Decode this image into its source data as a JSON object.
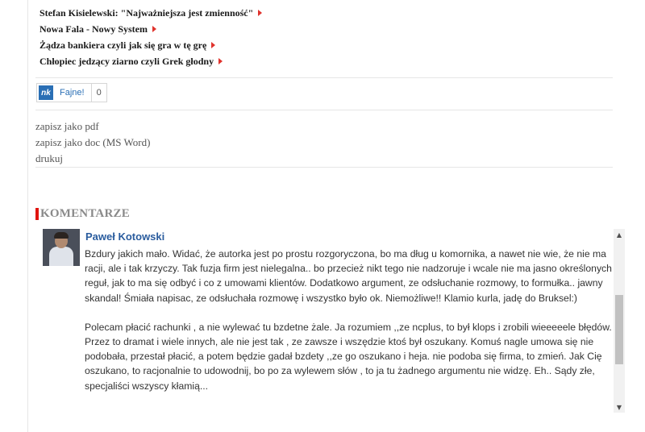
{
  "related_articles": [
    "Stefan Kisielewski: \"Najważniejsza jest zmienność\"",
    "Nowa Fala - Nowy System",
    "Żądza bankiera czyli jak się gra w tę grę",
    "Chłopiec jedzący ziarno czyli Grek głodny"
  ],
  "nk_widget": {
    "logo": "nk",
    "label": "Fajne!",
    "count": "0"
  },
  "actions": {
    "save_pdf": "zapisz jako pdf",
    "save_doc": "zapisz jako doc (MS Word)",
    "print": "drukuj"
  },
  "comments_section": {
    "heading": "KOMENTARZE",
    "comment": {
      "author": "Paweł Kotowski",
      "paragraphs": [
        "Bzdury jakich mało. Widać, że autorka jest po prostu rozgoryczona, bo ma dług u komornika, a nawet nie wie, że nie ma racji, ale i tak krzyczy. Tak fuzja firm jest nielegalna.. bo przecież nikt tego nie nadzoruje i wcale nie ma jasno określonych reguł, jak to ma się odbyć i co z umowami klientów. Dodatkowo argument, ze odsłuchanie rozmowy, to formułka.. jawny skandal! Śmiała napisac, ze odsłuchała rozmowę i wszystko było ok. Niemożliwe!! Klamio kurla, jadę do Bruksel:)",
        "Polecam płacić rachunki , a nie wylewać tu bzdetne żale. Ja rozumiem ,,ze ncplus, to był klops i zrobili wieeeeele błędów. Przez to dramat i wiele innych, ale nie jest tak , ze zawsze i wszędzie ktoś był oszukany. Komuś nagle umowa się nie podobała, przestał płacić, a potem będzie gadał bzdety ,,ze go oszukano i heja. nie podoba się firma, to zmień. Jak Cię oszukano, to racjonalnie to udowodnij, bo po za wylewem słów , to ja tu żadnego argumentu nie widzę. Eh.. Sądy złe, specjaliści wszyscy kłamią..."
      ]
    }
  }
}
